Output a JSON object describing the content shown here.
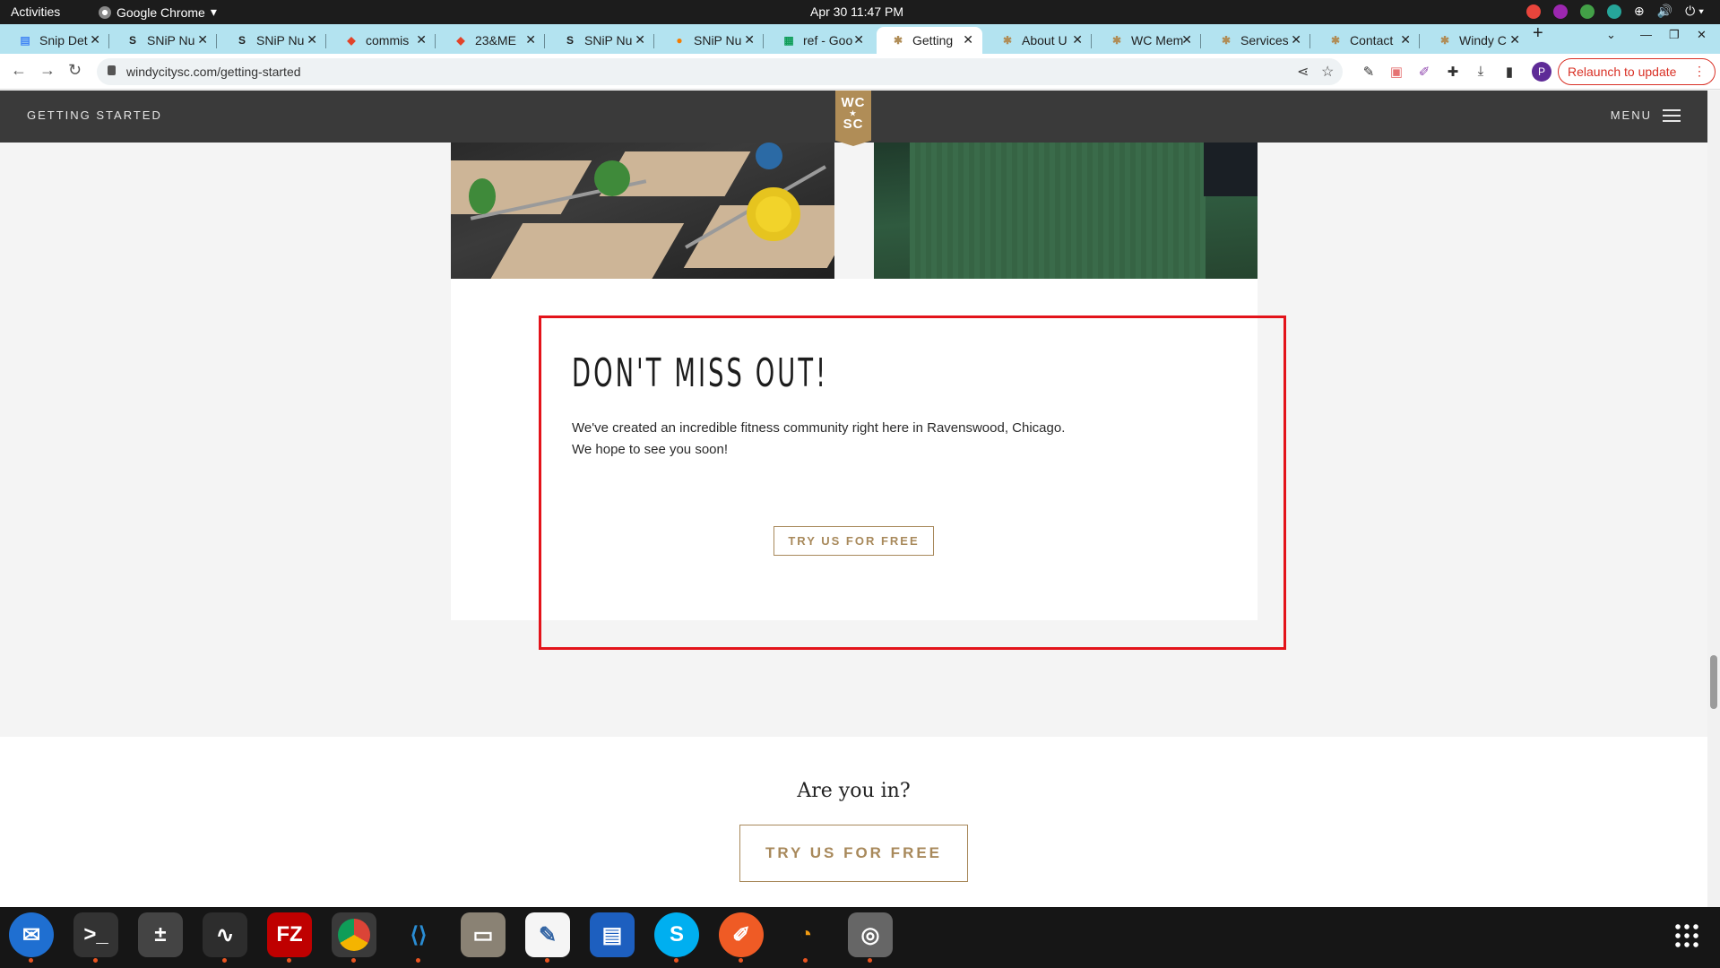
{
  "system": {
    "activities": "Activities",
    "app_name": "Google Chrome",
    "clock": "Apr 30  11:47 PM"
  },
  "tabs": [
    {
      "title": "Snip Det",
      "icon": "docs-icon"
    },
    {
      "title": "SNiP Nu",
      "icon": "snip-icon"
    },
    {
      "title": "SNiP Nu",
      "icon": "snip-icon"
    },
    {
      "title": "commis",
      "icon": "gitlab-icon"
    },
    {
      "title": "23&ME",
      "icon": "gitlab-icon"
    },
    {
      "title": "SNiP Nu",
      "icon": "snip-icon"
    },
    {
      "title": "SNiP Nu",
      "icon": "fruit-icon"
    },
    {
      "title": "ref - Goo",
      "icon": "sheets-icon"
    },
    {
      "title": "Getting",
      "icon": "star-icon",
      "active": true
    },
    {
      "title": "About U",
      "icon": "star-icon"
    },
    {
      "title": "WC Mem",
      "icon": "star-icon"
    },
    {
      "title": "Services",
      "icon": "star-icon"
    },
    {
      "title": "Contact",
      "icon": "star-icon"
    },
    {
      "title": "Windy C",
      "icon": "star-icon"
    }
  ],
  "toolbar": {
    "url": "windycitysc.com/getting-started",
    "profile_initial": "P",
    "relaunch_label": "Relaunch to update"
  },
  "site": {
    "nav_left": "GETTING STARTED",
    "logo_top": "WC",
    "logo_bottom": "SC",
    "menu_label": "MENU"
  },
  "promo": {
    "headline": "DON'T MISS OUT!",
    "line1": "We've created an incredible fitness community right here in Ravenswood, Chicago.",
    "line2": "We hope to see you soon!",
    "cta": "TRY US FOR FREE"
  },
  "footer": {
    "question": "Are you in?",
    "cta": "TRY US FOR FREE"
  },
  "dock": [
    "thunderbird-icon",
    "terminal-icon",
    "calculator-icon",
    "system-monitor-icon",
    "filezilla-icon",
    "chrome-icon",
    "vscode-icon",
    "files-icon",
    "text-editor-icon",
    "libreoffice-writer-icon",
    "skype-icon",
    "postman-icon",
    "hotspot-icon",
    "disk-icon"
  ]
}
